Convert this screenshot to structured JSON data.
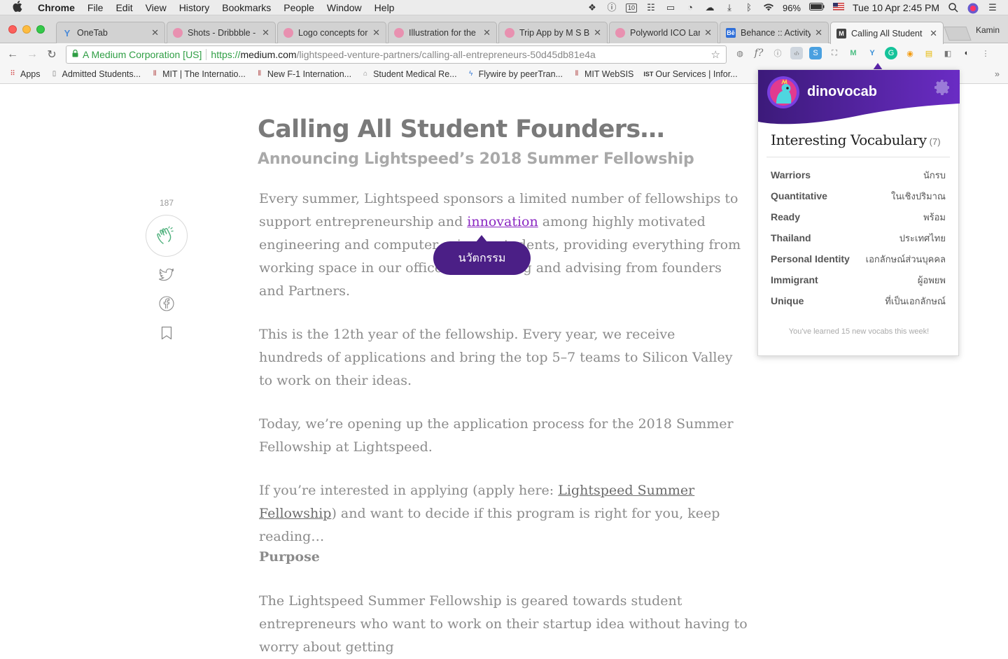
{
  "menubar": {
    "app": "Chrome",
    "items": [
      "File",
      "Edit",
      "View",
      "History",
      "Bookmarks",
      "People",
      "Window",
      "Help"
    ],
    "battery": "96%",
    "datetime": "Tue 10 Apr  2:45 PM",
    "calendar_day": "10"
  },
  "tabs": [
    {
      "title": "OneTab",
      "favicon_color": "#4a8ad8",
      "favicon": "funnel-icon"
    },
    {
      "title": "Shots - Dribbble -",
      "favicon_color": "#e06a93",
      "favicon": "dribbble-icon"
    },
    {
      "title": "Logo concepts for",
      "favicon_color": "#e06a93",
      "favicon": "dribbble-icon"
    },
    {
      "title": "Illustration for the",
      "favicon_color": "#e06a93",
      "favicon": "dribbble-icon"
    },
    {
      "title": "Trip App by M S B",
      "favicon_color": "#e06a93",
      "favicon": "dribbble-icon"
    },
    {
      "title": "Polyworld ICO Lan",
      "favicon_color": "#e06a93",
      "favicon": "dribbble-icon"
    },
    {
      "title": "Behance :: Activity",
      "favicon_color": "#2f6fd9",
      "favicon": "behance-icon",
      "favicon_text": "Bē"
    },
    {
      "title": "Calling All Student",
      "favicon_color": "#444444",
      "favicon": "medium-icon",
      "favicon_text": "M",
      "active": true
    }
  ],
  "profile_name": "Kamin",
  "omnibox": {
    "secure_label": "A Medium Corporation [US]",
    "scheme": "https://",
    "host": "medium.com",
    "path": "/lightspeed-venture-partners/calling-all-entrepreneurs-50d45db81e4a"
  },
  "bookmarks": [
    {
      "label": "Apps",
      "icon": "apps-grid-icon"
    },
    {
      "label": "Admitted Students...",
      "icon": "page-icon"
    },
    {
      "label": "MIT | The Internatio...",
      "icon": "mit-icon"
    },
    {
      "label": "New F-1 Internation...",
      "icon": "mit-icon"
    },
    {
      "label": "Student Medical Re...",
      "icon": "building-icon"
    },
    {
      "label": "Flywire by peerTran...",
      "icon": "flywire-icon"
    },
    {
      "label": "MIT WebSIS",
      "icon": "mit-icon"
    },
    {
      "label": "Our Services | Infor...",
      "icon": "ist-icon"
    }
  ],
  "article": {
    "title": "Calling All Student Founders…",
    "subtitle": "Announcing Lightspeed’s 2018 Summer Fellowship",
    "clap_count": "187",
    "p1_a": "Every summer, Lightspeed sponsors a limited number of fellowships to support entrepreneurship and ",
    "p1_link": "innovation",
    "p1_b": " among highly motivated engineering and computer science students, providing everything from working space in our offices to coaching and advising from founders and Partners.",
    "p2": "This is the 12th year of the fellowship. Every year, we receive hundreds of applications and bring the top 5–7 teams to Silicon Valley to work on their ideas.",
    "p3": "Today, we’re opening up the application process for the 2018 Summer Fellowship at Lightspeed.",
    "p4_a": "If you’re interested in applying (apply here: ",
    "p4_link": "Lightspeed Summer Fellowship",
    "p4_b": ") and want to decide if this program is right for you, keep reading…",
    "section": "Purpose",
    "p5": "The Lightspeed Summer Fellowship is geared towards student entrepreneurs who want to work on their startup idea without having to worry about getting"
  },
  "tooltip": {
    "translation": "นวัตกรรม"
  },
  "popup": {
    "brand": "dinovocab",
    "title": "Interesting Vocabulary",
    "count": "(7)",
    "vocab": [
      {
        "word": "Warriors",
        "translation": "นักรบ"
      },
      {
        "word": "Quantitative",
        "translation": "ในเชิงปริมาณ"
      },
      {
        "word": "Ready",
        "translation": "พร้อม"
      },
      {
        "word": "Thailand",
        "translation": "ประเทศไทย"
      },
      {
        "word": "Personal Identity",
        "translation": "เอกลักษณ์ส่วนบุคคล"
      },
      {
        "word": "Immigrant",
        "translation": "ผู้อพยพ"
      },
      {
        "word": "Unique",
        "translation": "ที่เป็นเอกลักษณ์"
      }
    ],
    "footer": "You've learned 15 new vocabs this week!",
    "colors": {
      "header": "#4b1f86",
      "accent": "#6a2fc0"
    }
  }
}
